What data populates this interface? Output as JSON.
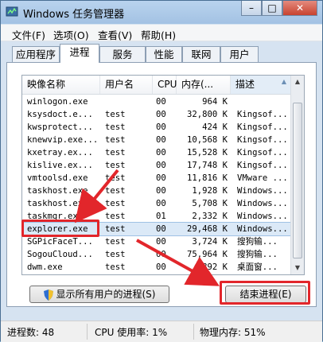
{
  "window": {
    "title": "Windows 任务管理器",
    "minimize": "–",
    "maximize": "□",
    "close": "✕"
  },
  "menu": [
    "文件(F)",
    "选项(O)",
    "查看(V)",
    "帮助(H)"
  ],
  "tabs": [
    "应用程序",
    "进程",
    "服务",
    "性能",
    "联网",
    "用户"
  ],
  "active_tab": "进程",
  "table": {
    "columns": [
      "映像名称",
      "用户名",
      "CPU",
      "内存(...",
      "描述"
    ],
    "sorted_column": "描述",
    "rows": [
      [
        "winlogon.exe",
        "",
        "00",
        "964 K",
        ""
      ],
      [
        "ksysdoct.e...",
        "test",
        "00",
        "32,800 K",
        "Kingsof..."
      ],
      [
        "kwsprotect...",
        "test",
        "00",
        "424 K",
        "Kingsof..."
      ],
      [
        "knewvip.exe...",
        "test",
        "00",
        "10,568 K",
        "Kingsof..."
      ],
      [
        "kxetray.ex...",
        "test",
        "00",
        "15,528 K",
        "Kingsof..."
      ],
      [
        "kislive.ex...",
        "test",
        "00",
        "17,748 K",
        "Kingsof..."
      ],
      [
        "vmtoolsd.exe",
        "test",
        "00",
        "11,816 K",
        "VMware ..."
      ],
      [
        "taskhost.exe",
        "test",
        "00",
        "1,928 K",
        "Windows..."
      ],
      [
        "taskhost.exe",
        "test",
        "00",
        "5,708 K",
        "Windows..."
      ],
      [
        "taskmgr.exe",
        "test",
        "01",
        "2,332 K",
        "Windows..."
      ],
      [
        "explorer.exe",
        "test",
        "00",
        "29,468 K",
        "Windows..."
      ],
      [
        "SGPicFaceT...",
        "test",
        "00",
        "3,724 K",
        "搜狗输..."
      ],
      [
        "SogouCloud...",
        "test",
        "00",
        "75,964 K",
        "搜狗输..."
      ],
      [
        "dwm.exe",
        "test",
        "00",
        "892 K",
        "桌面窗..."
      ]
    ],
    "selected_row": 10
  },
  "buttons": {
    "show_all": "显示所有用户的进程(S)",
    "end_process": "结束进程(E)"
  },
  "status": {
    "processes": "进程数: 48",
    "cpu": "CPU 使用率: 1%",
    "memory": "物理内存: 51%"
  },
  "colors": {
    "annotation": "#e2262b",
    "titlebar": "#a3c2e3",
    "selection": "#dbe9f7"
  },
  "icons": {
    "app": "task-manager-icon",
    "shield": "uac-shield-icon"
  }
}
